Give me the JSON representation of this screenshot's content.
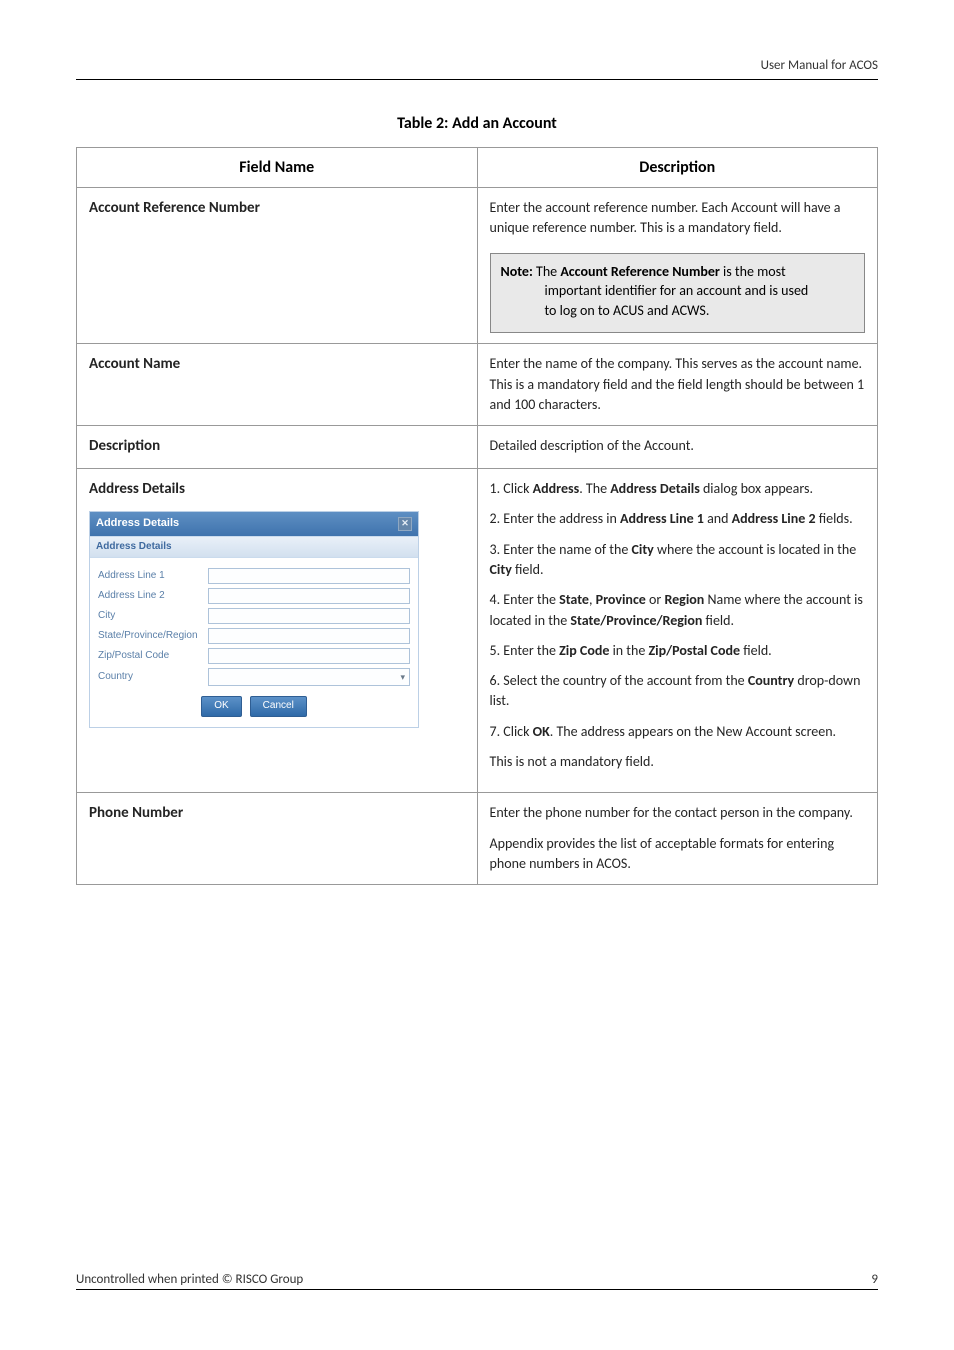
{
  "header": {
    "right_text": "User Manual for ACOS"
  },
  "table_title": "Table 2: Add an Account",
  "columns": {
    "field": "Field Name",
    "desc": "Description"
  },
  "rows": {
    "acct_ref": {
      "label": "Account Reference Number",
      "desc1": "Enter the account reference number. Each Account will have a unique reference number. This is a mandatory field.",
      "note_prefix": "Note:",
      "note_mid": " The ",
      "note_bold": "Account Reference Number",
      "note_line1_tail": " is the most",
      "note_line2": "important identifier for an account and is used",
      "note_line3": "to log on to ACUS and ACWS."
    },
    "acct_name": {
      "label": "Account Name",
      "desc": "Enter the name of the company. This serves as the account name. This is a mandatory field and the field length should be between 1 and 100 characters."
    },
    "description": {
      "label": "Description",
      "desc": "Detailed description of the Account."
    },
    "address": {
      "label": "Address Details",
      "steps": {
        "s1a": "1. Click ",
        "s1b": "Address",
        "s1c": ". The ",
        "s1d": "Address Details",
        "s1e": " dialog box appears.",
        "s2a": "2. Enter the address in ",
        "s2b": "Address Line 1",
        "s2c": " and ",
        "s2d": "Address Line 2",
        "s2e": " fields.",
        "s3a": "3. Enter the name of the ",
        "s3b": "City",
        "s3c": " where the account is located in the ",
        "s3d": "City",
        "s3e": " field.",
        "s4a": "4. Enter the ",
        "s4b": "State",
        "s4c": ", ",
        "s4d": "Province",
        "s4e": " or ",
        "s4f": "Region",
        "s4g": " Name where the account is located in the ",
        "s4h": "State/Province/Region",
        "s4i": " field.",
        "s5a": "5. Enter the ",
        "s5b": "Zip Code",
        "s5c": " in the ",
        "s5d": "Zip/Postal Code",
        "s5e": " field.",
        "s6a": "6. Select the country of the account from the ",
        "s6b": "Country",
        "s6c": " drop-down list.",
        "s7a": "7. Click ",
        "s7b": "OK",
        "s7c": ". The address appears on the New Account screen.",
        "s8": "This is not a mandatory field."
      },
      "dialog": {
        "title": "Address Details",
        "subhead": "Address Details",
        "labels": {
          "l1": "Address Line 1",
          "l2": "Address Line 2",
          "l3": "City",
          "l4": "State/Province/Region",
          "l5": "Zip/Postal Code",
          "l6": "Country"
        },
        "ok": "OK",
        "cancel": "Cancel"
      }
    },
    "phone": {
      "label": "Phone Number",
      "p1": "Enter the phone number for the contact person in the company.",
      "p2": "Appendix provides the list of acceptable formats for entering phone numbers in ACOS."
    }
  },
  "footer": {
    "left": "Uncontrolled when printed © RISCO Group",
    "right": "9"
  }
}
